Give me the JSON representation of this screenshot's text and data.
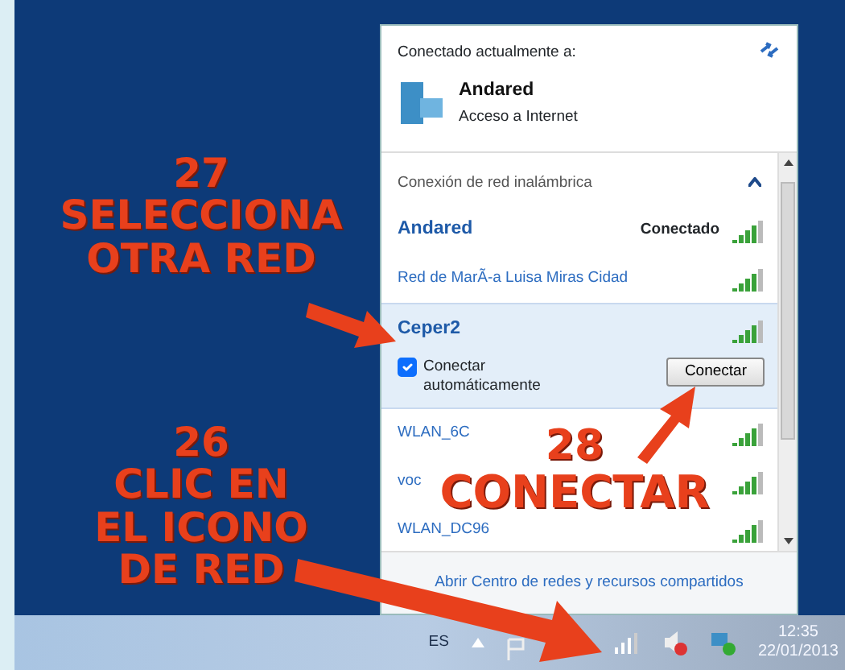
{
  "annotations": [
    {
      "kind": "left",
      "lines": [
        "27",
        "SELECCIONA",
        "OTRA RED"
      ]
    },
    {
      "kind": "left",
      "lines": [
        "26",
        "CLIC EN",
        "EL ICONO",
        "DE RED"
      ]
    },
    {
      "kind": "inline",
      "lines": [
        "28",
        "CONECTAR"
      ]
    }
  ],
  "panel": {
    "connected_label": "Conectado actualmente a:",
    "current": {
      "name": "Andared",
      "status": "Acceso a Internet"
    },
    "section": {
      "title": "Conexión de red inalámbrica",
      "expanded": true
    },
    "networks": [
      {
        "name": "Andared",
        "status": "Conectado",
        "connected": true,
        "selected": false
      },
      {
        "name": "Red de MarÃ-a Luisa Miras Cidad",
        "connected": false,
        "selected": false
      },
      {
        "name": "Ceper2",
        "connected": false,
        "selected": true,
        "auto_label": "Conectar automáticamente",
        "auto_checked": true,
        "button": "Conectar"
      },
      {
        "name": "WLAN_6C",
        "connected": false,
        "selected": false
      },
      {
        "name": "voc",
        "connected": false,
        "selected": false
      },
      {
        "name": "WLAN_DC96",
        "connected": false,
        "selected": false
      }
    ],
    "footer_link": "Abrir Centro de redes y recursos compartidos"
  },
  "taskbar": {
    "language": "ES",
    "time": "12:35",
    "date": "22/01/2013"
  }
}
